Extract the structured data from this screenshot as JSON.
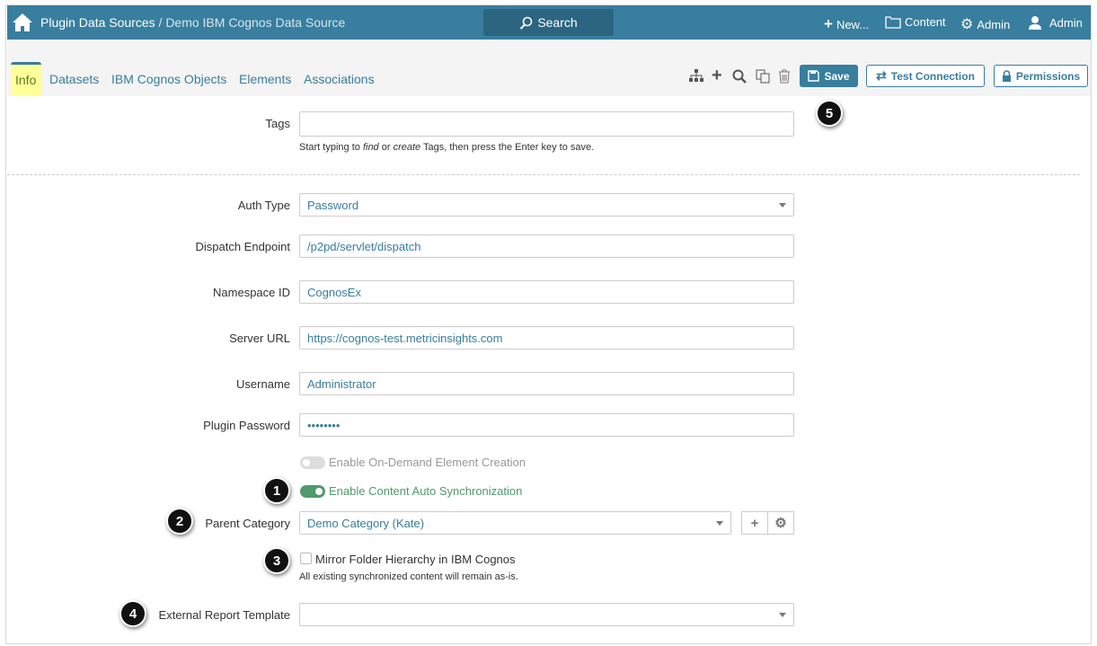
{
  "header": {
    "breadcrumb_root": "Plugin Data Sources",
    "breadcrumb_sep": " / ",
    "breadcrumb_current": "Demo IBM Cognos Data Source",
    "search_label": "Search",
    "new_label": "New...",
    "content_label": "Content",
    "admin_label": "Admin",
    "user_label": "Admin"
  },
  "tabs": [
    {
      "label": "Info",
      "active": true
    },
    {
      "label": "Datasets"
    },
    {
      "label": "IBM Cognos Objects"
    },
    {
      "label": "Elements"
    },
    {
      "label": "Associations"
    }
  ],
  "toolbar": {
    "save_label": "Save",
    "test_label": "Test Connection",
    "permissions_label": "Permissions"
  },
  "form": {
    "tags": {
      "label": "Tags",
      "value": "",
      "help_pre": "Start typing to ",
      "help_find": "find",
      "help_or": " or ",
      "help_create": "create",
      "help_post": " Tags, then press the Enter key to save."
    },
    "auth_type": {
      "label": "Auth Type",
      "value": "Password"
    },
    "dispatch": {
      "label": "Dispatch Endpoint",
      "value": "/p2pd/servlet/dispatch"
    },
    "namespace": {
      "label": "Namespace ID",
      "value": "CognosEx"
    },
    "server_url": {
      "label": "Server URL",
      "value": "https://cognos-test.metricinsights.com"
    },
    "username": {
      "label": "Username",
      "value": "Administrator"
    },
    "password": {
      "label": "Plugin Password",
      "value": "••••••••"
    },
    "on_demand": {
      "label": "Enable On-Demand Element Creation",
      "enabled": false
    },
    "auto_sync": {
      "label": "Enable Content Auto Synchronization",
      "enabled": true
    },
    "parent_category": {
      "label": "Parent Category",
      "value": "Demo Category (Kate)"
    },
    "mirror": {
      "label": "Mirror Folder Hierarchy in IBM Cognos",
      "checked": false,
      "help": "All existing synchronized content will remain as-is."
    },
    "external_template": {
      "label": "External Report Template",
      "value": ""
    }
  },
  "badges": [
    "1",
    "2",
    "3",
    "4",
    "5"
  ]
}
